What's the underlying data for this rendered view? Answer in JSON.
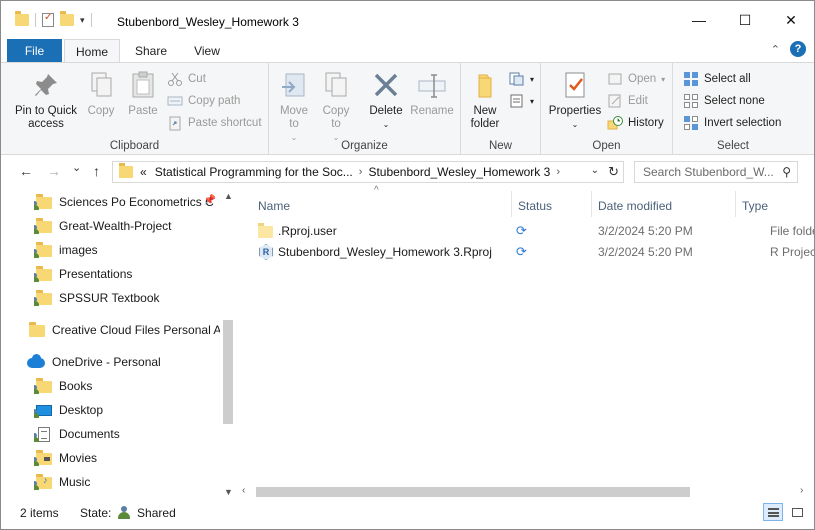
{
  "title_bar": {
    "title": "Stubenbord_Wesley_Homework 3",
    "qat_dropdown": "▾",
    "minimize": "—",
    "maximize": "☐",
    "close": "✕"
  },
  "tabs": {
    "file": "File",
    "home": "Home",
    "share": "Share",
    "view": "View",
    "collapse": "⌃",
    "help": "?"
  },
  "ribbon": {
    "clipboard": {
      "label": "Clipboard",
      "pin": "Pin to Quick access",
      "copy": "Copy",
      "paste": "Paste",
      "cut": "Cut",
      "copy_path": "Copy path",
      "paste_shortcut": "Paste shortcut"
    },
    "organize": {
      "label": "Organize",
      "move_to": "Move to",
      "copy_to": "Copy to",
      "delete": "Delete",
      "rename": "Rename"
    },
    "new": {
      "label": "New",
      "new_folder": "New folder"
    },
    "open": {
      "label": "Open",
      "properties": "Properties",
      "open": "Open",
      "edit": "Edit",
      "history": "History"
    },
    "select": {
      "label": "Select",
      "select_all": "Select all",
      "select_none": "Select none",
      "invert": "Invert selection"
    }
  },
  "address": {
    "prefix": "«",
    "crumbs": [
      "Statistical Programming for the Soc...",
      "Stubenbord_Wesley_Homework 3"
    ],
    "separator": "›",
    "dropdown": "⌄",
    "refresh": "↻",
    "back": "←",
    "forward": "→",
    "recent": "⌄",
    "up": "↑"
  },
  "search": {
    "placeholder": "Search Stubenbord_W...",
    "icon": "⚲"
  },
  "nav_pane": {
    "items": [
      {
        "label": "Sciences Po Econometrics C",
        "icon": "shared-folder-icon"
      },
      {
        "label": "Great-Wealth-Project",
        "icon": "shared-folder-icon"
      },
      {
        "label": "images",
        "icon": "shared-folder-icon"
      },
      {
        "label": "Presentations",
        "icon": "shared-folder-icon"
      },
      {
        "label": "SPSSUR Textbook",
        "icon": "shared-folder-icon"
      },
      {
        "label": "Creative Cloud Files Personal Ac",
        "icon": "folder-icon"
      },
      {
        "label": "OneDrive - Personal",
        "icon": "onedrive-icon"
      },
      {
        "label": "Books",
        "icon": "shared-folder-icon"
      },
      {
        "label": "Desktop",
        "icon": "desktop-icon"
      },
      {
        "label": "Documents",
        "icon": "documents-icon"
      },
      {
        "label": "Movies",
        "icon": "shared-folder-icon"
      },
      {
        "label": "Music",
        "icon": "shared-folder-icon"
      }
    ],
    "pin": "📌"
  },
  "file_list": {
    "columns": {
      "name": "Name",
      "status": "Status",
      "date": "Date modified",
      "type": "Type"
    },
    "sort_caret": "^",
    "rows": [
      {
        "name": ".Rproj.user",
        "status": "sync",
        "date": "3/2/2024 5:20 PM",
        "type": "File folder"
      },
      {
        "name": "Stubenbord_Wesley_Homework 3.Rproj",
        "status": "sync",
        "date": "3/2/2024 5:20 PM",
        "type": "R Project"
      }
    ],
    "sync_glyph": "⟳",
    "rproj_glyph": "R"
  },
  "status_bar": {
    "items": "2 items",
    "state_label": "State:",
    "state_value": "Shared"
  },
  "accent": "#1a6fb5"
}
